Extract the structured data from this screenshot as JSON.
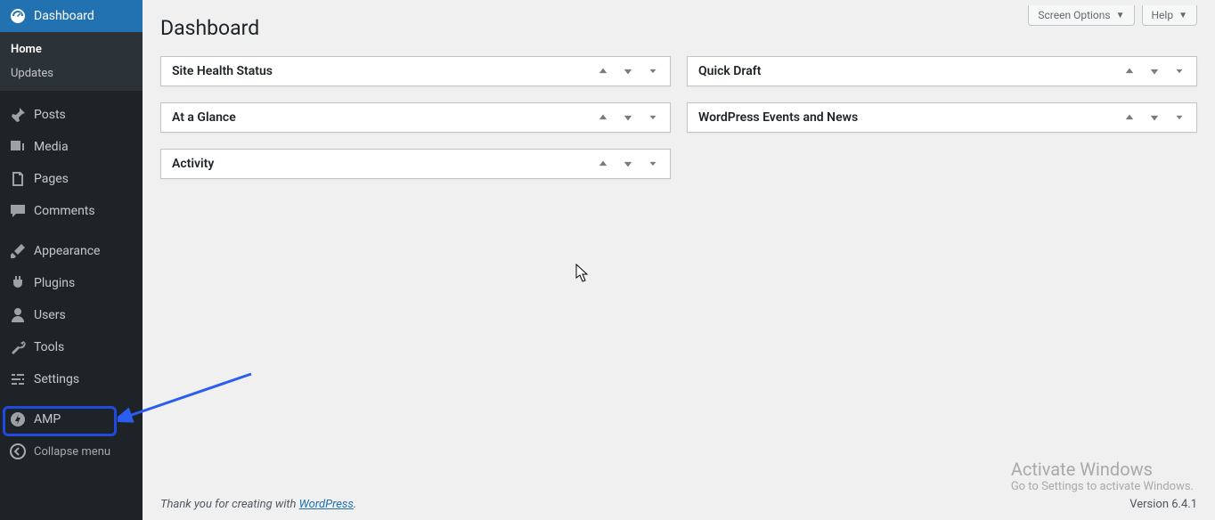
{
  "sidebar": {
    "dashboard_label": "Dashboard",
    "submenu": {
      "home": "Home",
      "updates": "Updates"
    },
    "posts": "Posts",
    "media": "Media",
    "pages": "Pages",
    "comments": "Comments",
    "appearance": "Appearance",
    "plugins": "Plugins",
    "users": "Users",
    "tools": "Tools",
    "settings": "Settings",
    "amp": "AMP",
    "collapse": "Collapse menu"
  },
  "topbar": {
    "screen_options": "Screen Options",
    "help": "Help"
  },
  "page_title": "Dashboard",
  "widgets": {
    "site_health": "Site Health Status",
    "at_a_glance": "At a Glance",
    "activity": "Activity",
    "quick_draft": "Quick Draft",
    "events_news": "WordPress Events and News"
  },
  "footer": {
    "thanks_prefix": "Thank you for creating with ",
    "wp_link": "WordPress",
    "thanks_suffix": ".",
    "version": "Version 6.4.1"
  },
  "watermark": {
    "line1": "Activate Windows",
    "line2": "Go to Settings to activate Windows."
  }
}
